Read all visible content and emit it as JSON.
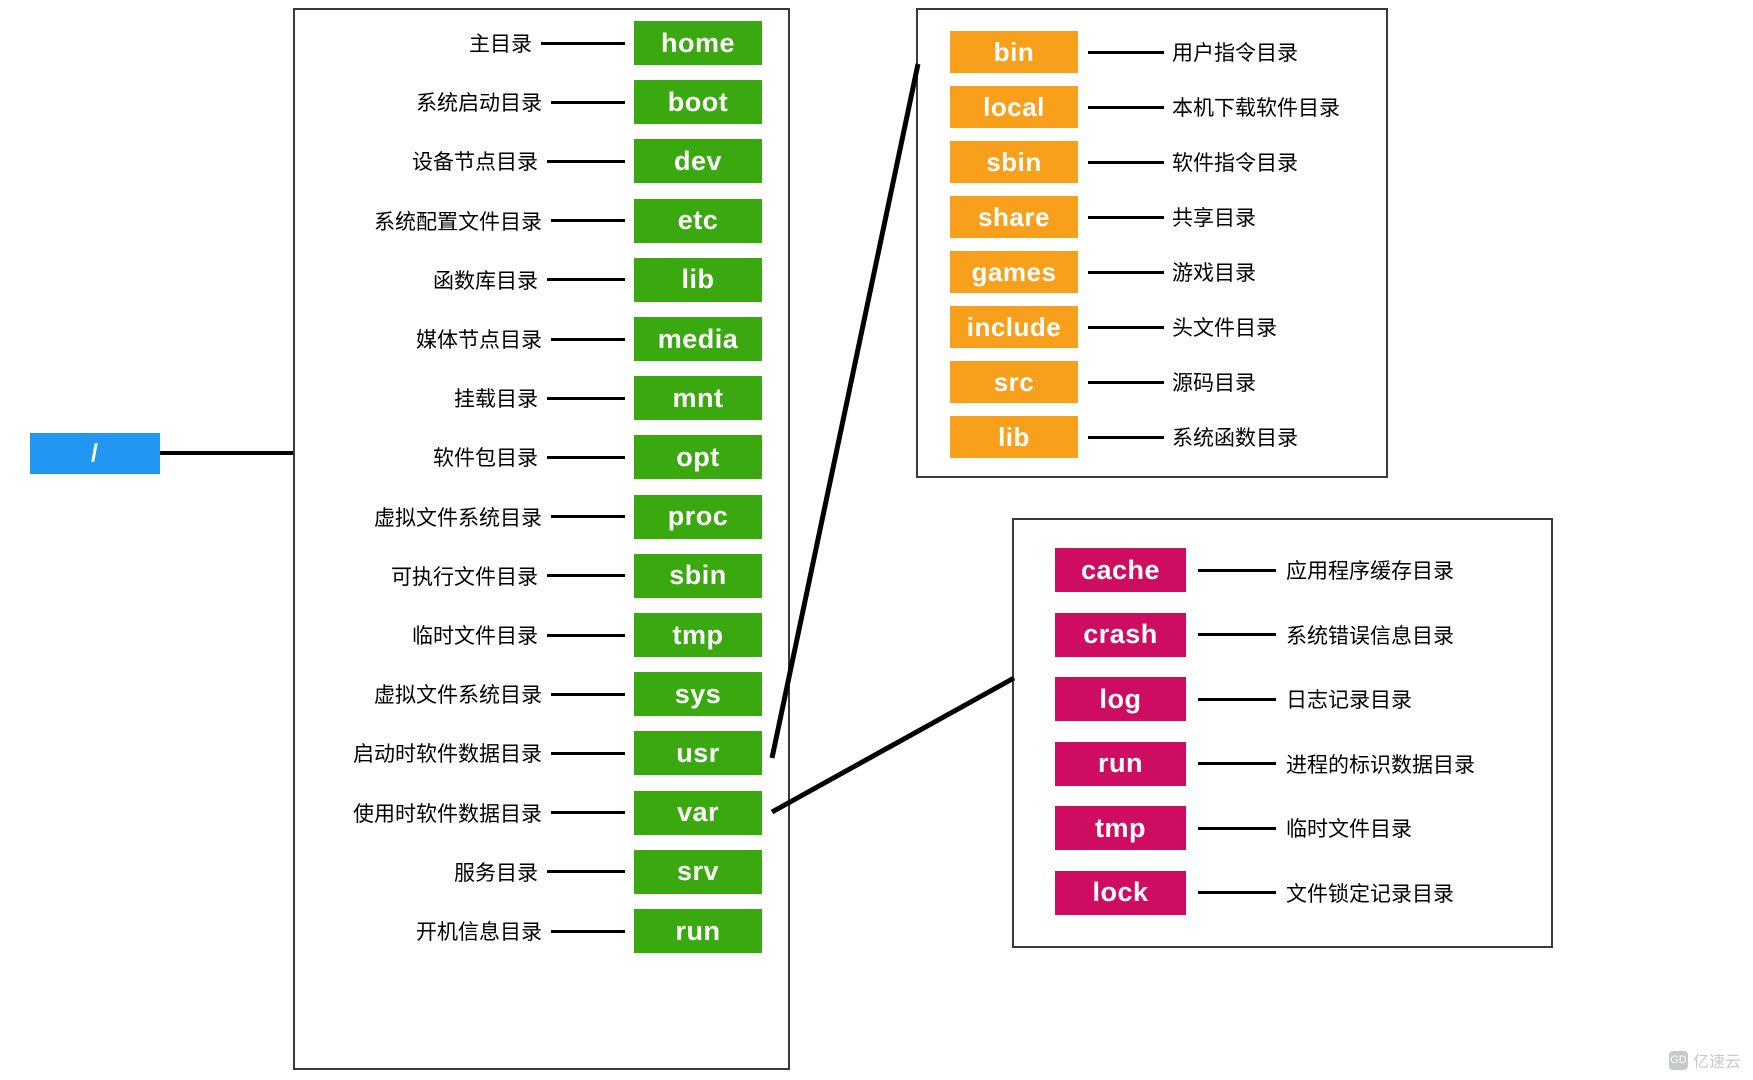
{
  "root": {
    "label": "/",
    "color": "#2196f3"
  },
  "colors": {
    "green": "#3aa80f",
    "orange": "#f8a01b",
    "magenta": "#ce0d62",
    "blue": "#2196f3",
    "line": "#000000"
  },
  "root_panel": {
    "rows": [
      {
        "desc": "主目录",
        "name": "home",
        "dash": 84
      },
      {
        "desc": "系统启动目录",
        "name": "boot",
        "dash": 74
      },
      {
        "desc": "设备节点目录",
        "name": "dev",
        "dash": 78
      },
      {
        "desc": "系统配置文件目录",
        "name": "etc",
        "dash": 74
      },
      {
        "desc": "函数库目录",
        "name": "lib",
        "dash": 78
      },
      {
        "desc": "媒体节点目录",
        "name": "media",
        "dash": 74
      },
      {
        "desc": "挂载目录",
        "name": "mnt",
        "dash": 78
      },
      {
        "desc": "软件包目录",
        "name": "opt",
        "dash": 78
      },
      {
        "desc": "虚拟文件系统目录",
        "name": "proc",
        "dash": 74
      },
      {
        "desc": "可执行文件目录",
        "name": "sbin",
        "dash": 78
      },
      {
        "desc": "临时文件目录",
        "name": "tmp",
        "dash": 78
      },
      {
        "desc": "虚拟文件系统目录",
        "name": "sys",
        "dash": 74
      },
      {
        "desc": "启动时软件数据目录",
        "name": "usr",
        "dash": 74
      },
      {
        "desc": "使用时软件数据目录",
        "name": "var",
        "dash": 74
      },
      {
        "desc": "服务目录",
        "name": "srv",
        "dash": 78
      },
      {
        "desc": "开机信息目录",
        "name": "run",
        "dash": 74
      }
    ]
  },
  "usr_panel": {
    "rows": [
      {
        "name": "bin",
        "desc": "用户指令目录"
      },
      {
        "name": "local",
        "desc": "本机下载软件目录"
      },
      {
        "name": "sbin",
        "desc": "软件指令目录"
      },
      {
        "name": "share",
        "desc": "共享目录"
      },
      {
        "name": "games",
        "desc": "游戏目录"
      },
      {
        "name": "include",
        "desc": "头文件目录"
      },
      {
        "name": "src",
        "desc": "源码目录"
      },
      {
        "name": "lib",
        "desc": "系统函数目录"
      }
    ]
  },
  "var_panel": {
    "rows": [
      {
        "name": "cache",
        "desc": "应用程序缓存目录"
      },
      {
        "name": "crash",
        "desc": "系统错误信息目录"
      },
      {
        "name": "log",
        "desc": "日志记录目录"
      },
      {
        "name": "run",
        "desc": "进程的标识数据目录"
      },
      {
        "name": "tmp",
        "desc": "临时文件目录"
      },
      {
        "name": "lock",
        "desc": "文件锁定记录目录"
      }
    ]
  },
  "watermark": {
    "mark": "GD",
    "text": "亿速云"
  }
}
